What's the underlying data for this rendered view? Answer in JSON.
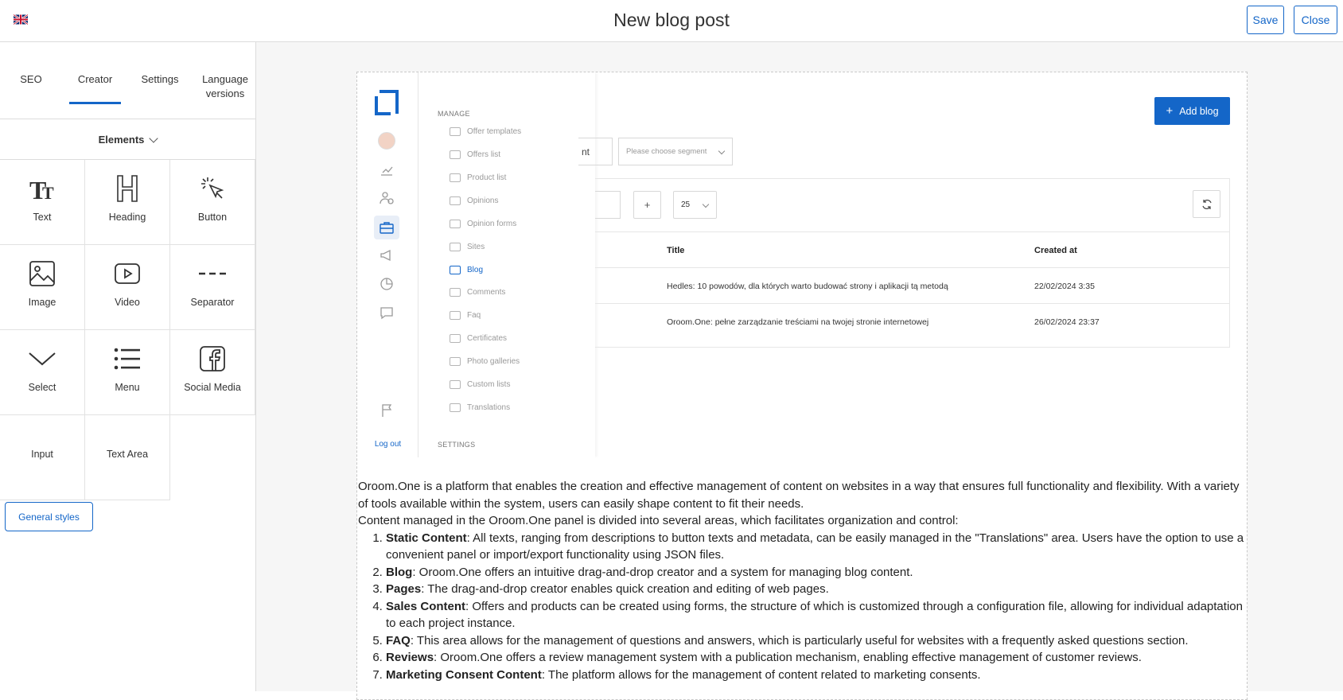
{
  "header": {
    "title": "New blog post",
    "save_label": "Save",
    "close_label": "Close",
    "flag_icon": "uk-flag-icon"
  },
  "sidebar": {
    "tabs": [
      {
        "label": "SEO"
      },
      {
        "label": "Creator",
        "active": true
      },
      {
        "label": "Settings"
      },
      {
        "label": "Language versions"
      }
    ],
    "elements_label": "Elements",
    "elements": [
      {
        "label": "Text",
        "icon": "text-icon"
      },
      {
        "label": "Heading",
        "icon": "heading-icon"
      },
      {
        "label": "Button",
        "icon": "button-click-icon"
      },
      {
        "label": "Image",
        "icon": "image-icon"
      },
      {
        "label": "Video",
        "icon": "video-icon"
      },
      {
        "label": "Separator",
        "icon": "separator-icon"
      },
      {
        "label": "Select",
        "icon": "select-chevron-icon"
      },
      {
        "label": "Menu",
        "icon": "menu-list-icon"
      },
      {
        "label": "Social Media",
        "icon": "facebook-icon"
      },
      {
        "label": "Input"
      },
      {
        "label": "Text Area"
      }
    ],
    "general_styles_label": "General styles"
  },
  "embedded": {
    "manage_label": "MANAGE",
    "settings_label": "SETTINGS",
    "logout_label": "Log out",
    "menu": [
      {
        "label": "Offer templates"
      },
      {
        "label": "Offers list"
      },
      {
        "label": "Product list"
      },
      {
        "label": "Opinions"
      },
      {
        "label": "Opinion forms"
      },
      {
        "label": "Sites"
      },
      {
        "label": "Blog",
        "active": true
      },
      {
        "label": "Comments"
      },
      {
        "label": "Faq"
      },
      {
        "label": "Certificates"
      },
      {
        "label": "Photo galleries"
      },
      {
        "label": "Custom lists"
      },
      {
        "label": "Translations"
      }
    ],
    "add_blog_label": "Add blog",
    "segment_partial": "nt",
    "segment_placeholder": "Please choose segment",
    "per_page": "25",
    "columns": {
      "title": "Title",
      "created": "Created at"
    },
    "rows": [
      {
        "title": "Hedles: 10 powodów, dla których warto budować strony i aplikacji tą metodą",
        "created": "22/02/2024 3:35"
      },
      {
        "title": "Oroom.One: pełne zarządzanie treściami na twojej stronie internetowej",
        "created": "26/02/2024 23:37"
      }
    ]
  },
  "article": {
    "intro": "Oroom.One is a platform that enables the creation and effective management of content on websites in a way that ensures full functionality and flexibility. With a variety of tools available within the system, users can easily shape content to fit their needs.",
    "lead": "Content managed in the Oroom.One panel is divided into several areas, which facilitates organization and control:",
    "items": [
      {
        "term": "Static Content",
        "text": ": All texts, ranging from descriptions to button texts and metadata, can be easily managed in the \"Translations\" area. Users have the option to use a convenient panel or import/export functionality using JSON files."
      },
      {
        "term": "Blog",
        "text": ": Oroom.One offers an intuitive drag-and-drop creator and a system for managing blog content."
      },
      {
        "term": "Pages",
        "text": ": The drag-and-drop creator enables quick creation and editing of web pages."
      },
      {
        "term": "Sales Content",
        "text": ": Offers and products can be created using forms, the structure of which is customized through a configuration file, allowing for individual adaptation to each project instance."
      },
      {
        "term": "FAQ",
        "text": ": This area allows for the management of questions and answers, which is particularly useful for websites with a frequently asked questions section."
      },
      {
        "term": "Reviews",
        "text": ": Oroom.One offers a review management system with a publication mechanism, enabling effective management of customer reviews."
      },
      {
        "term": "Marketing Consent Content",
        "text": ": The platform allows for the management of content related to marketing consents."
      }
    ]
  },
  "colors": {
    "accent": "#1466c8",
    "border": "#dcdcdc",
    "canvas": "#f6f6f6"
  }
}
